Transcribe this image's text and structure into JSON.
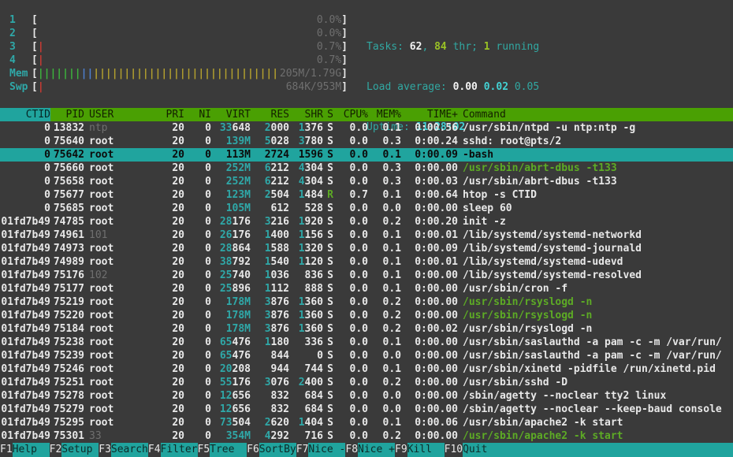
{
  "colors": {
    "background": "#3a3a3a",
    "header_bg": "#4aa003",
    "accent_teal": "#20a49e",
    "text": "#e8e8e8",
    "dim_gray": "#6f6f6f",
    "cyan_number": "#2fa8a8",
    "bright_cyan": "#43d1d3",
    "green_command": "#5dab25",
    "lime_bold": "#9ac225",
    "meter_red": "#cc3b33",
    "meter_green": "#3cb43c",
    "meter_blue": "#4d80d0",
    "meter_yellow": "#b3a02e"
  },
  "meters": [
    {
      "name": "cpu-1",
      "label": "1",
      "text": "0.0%",
      "pipes": []
    },
    {
      "name": "cpu-2",
      "label": "2",
      "text": "0.0%",
      "pipes": []
    },
    {
      "name": "cpu-3",
      "label": "3",
      "text": "0.7%",
      "pipes": [
        {
          "color": "red",
          "count": 1
        }
      ]
    },
    {
      "name": "cpu-4",
      "label": "4",
      "text": "0.7%",
      "pipes": [
        {
          "color": "red",
          "count": 1
        }
      ]
    },
    {
      "name": "memory",
      "label": "Mem",
      "text": "205M/1.79G",
      "pipes": [
        {
          "color": "green",
          "count": 7
        },
        {
          "color": "blue",
          "count": 2
        },
        {
          "color": "yellow",
          "count": 30
        }
      ]
    },
    {
      "name": "swap",
      "label": "Swp",
      "text": "684K/953M",
      "pipes": [
        {
          "color": "red",
          "count": 1
        }
      ]
    }
  ],
  "summary": {
    "tasks": [
      {
        "t": "Tasks: ",
        "c": "lbl"
      },
      {
        "t": "62",
        "c": "wb"
      },
      {
        "t": ", ",
        "c": "lbl"
      },
      {
        "t": "84",
        "c": "gb"
      },
      {
        "t": " thr; ",
        "c": "lbl"
      },
      {
        "t": "1",
        "c": "gb"
      },
      {
        "t": " running",
        "c": "lbl"
      }
    ],
    "load": [
      {
        "t": "Load average: ",
        "c": "lbl"
      },
      {
        "t": "0.00",
        "c": "wb"
      },
      {
        "t": " ",
        "c": "lbl"
      },
      {
        "t": "0.02",
        "c": "cb"
      },
      {
        "t": " ",
        "c": "lbl"
      },
      {
        "t": "0.05",
        "c": "lbl"
      }
    ],
    "uptime": [
      {
        "t": "Uptime: ",
        "c": "lbl"
      },
      {
        "t": "11:28:02",
        "c": "cb"
      }
    ]
  },
  "table": {
    "columns": [
      {
        "key": "ctid",
        "label": "CTID",
        "align": "r",
        "sorted": true
      },
      {
        "key": "pid",
        "label": "PID",
        "align": "r"
      },
      {
        "key": "user",
        "label": "USER",
        "align": "l"
      },
      {
        "key": "pri",
        "label": "PRI",
        "align": "r"
      },
      {
        "key": "ni",
        "label": "NI",
        "align": "r"
      },
      {
        "key": "virt",
        "label": "VIRT",
        "align": "r"
      },
      {
        "key": "res",
        "label": "RES",
        "align": "r"
      },
      {
        "key": "shr",
        "label": "SHR",
        "align": "r"
      },
      {
        "key": "s",
        "label": "S",
        "align": "r"
      },
      {
        "key": "cpu",
        "label": "CPU%",
        "align": "r"
      },
      {
        "key": "mem",
        "label": "MEM%",
        "align": "r"
      },
      {
        "key": "time",
        "label": "TIME+",
        "align": "r"
      },
      {
        "key": "cmd",
        "label": "Command",
        "align": "l"
      }
    ],
    "rows": [
      {
        "ctid": "0",
        "pid": "13832",
        "user": "ntp",
        "dimUser": true,
        "pri": "20",
        "ni": "0",
        "virt": "33648",
        "res": "2000",
        "shr": "1376",
        "s": "S",
        "cpu": "0.0",
        "mem": "0.1",
        "time": "0:00.56",
        "cmd": "/usr/sbin/ntpd -u ntp:ntp -g"
      },
      {
        "ctid": "0",
        "pid": "75640",
        "user": "root",
        "pri": "20",
        "ni": "0",
        "virt": "139M",
        "res": "5028",
        "shr": "3780",
        "s": "S",
        "cpu": "0.0",
        "mem": "0.3",
        "time": "0:00.24",
        "cmd": "sshd: root@pts/2"
      },
      {
        "ctid": "0",
        "pid": "75642",
        "user": "root",
        "pri": "20",
        "ni": "0",
        "virt": "113M",
        "res": "2724",
        "shr": "1596",
        "s": "S",
        "cpu": "0.0",
        "mem": "0.1",
        "time": "0:00.09",
        "cmd": "-bash",
        "selected": true
      },
      {
        "ctid": "0",
        "pid": "75660",
        "user": "root",
        "pri": "20",
        "ni": "0",
        "virt": "252M",
        "res": "6212",
        "shr": "4304",
        "s": "S",
        "cpu": "0.0",
        "mem": "0.3",
        "time": "0:00.00",
        "cmd": "/usr/sbin/abrt-dbus -t133",
        "greenCmd": true
      },
      {
        "ctid": "0",
        "pid": "75658",
        "user": "root",
        "pri": "20",
        "ni": "0",
        "virt": "252M",
        "res": "6212",
        "shr": "4304",
        "s": "S",
        "cpu": "0.0",
        "mem": "0.3",
        "time": "0:00.03",
        "cmd": "/usr/sbin/abrt-dbus -t133"
      },
      {
        "ctid": "0",
        "pid": "75677",
        "user": "root",
        "pri": "20",
        "ni": "0",
        "virt": "123M",
        "res": "2504",
        "shr": "1484",
        "s": "R",
        "cpu": "0.7",
        "mem": "0.1",
        "time": "0:00.64",
        "cmd": "htop -s CTID"
      },
      {
        "ctid": "0",
        "pid": "75685",
        "user": "root",
        "pri": "20",
        "ni": "0",
        "virt": "105M",
        "res": "612",
        "shr": "528",
        "s": "S",
        "cpu": "0.0",
        "mem": "0.0",
        "time": "0:00.00",
        "cmd": "sleep 60"
      },
      {
        "ctid": "01fd7b49",
        "pid": "74785",
        "user": "root",
        "pri": "20",
        "ni": "0",
        "virt": "28176",
        "res": "3216",
        "shr": "1920",
        "s": "S",
        "cpu": "0.0",
        "mem": "0.2",
        "time": "0:00.20",
        "cmd": "init -z"
      },
      {
        "ctid": "01fd7b49",
        "pid": "74961",
        "user": "101",
        "dimUser": true,
        "pri": "20",
        "ni": "0",
        "virt": "26176",
        "res": "1400",
        "shr": "1156",
        "s": "S",
        "cpu": "0.0",
        "mem": "0.1",
        "time": "0:00.01",
        "cmd": "/lib/systemd/systemd-networkd"
      },
      {
        "ctid": "01fd7b49",
        "pid": "74973",
        "user": "root",
        "pri": "20",
        "ni": "0",
        "virt": "28864",
        "res": "1588",
        "shr": "1320",
        "s": "S",
        "cpu": "0.0",
        "mem": "0.1",
        "time": "0:00.09",
        "cmd": "/lib/systemd/systemd-journald"
      },
      {
        "ctid": "01fd7b49",
        "pid": "74989",
        "user": "root",
        "pri": "20",
        "ni": "0",
        "virt": "38792",
        "res": "1540",
        "shr": "1120",
        "s": "S",
        "cpu": "0.0",
        "mem": "0.1",
        "time": "0:00.01",
        "cmd": "/lib/systemd/systemd-udevd"
      },
      {
        "ctid": "01fd7b49",
        "pid": "75176",
        "user": "102",
        "dimUser": true,
        "pri": "20",
        "ni": "0",
        "virt": "25740",
        "res": "1036",
        "shr": "836",
        "s": "S",
        "cpu": "0.0",
        "mem": "0.1",
        "time": "0:00.00",
        "cmd": "/lib/systemd/systemd-resolved"
      },
      {
        "ctid": "01fd7b49",
        "pid": "75177",
        "user": "root",
        "pri": "20",
        "ni": "0",
        "virt": "25896",
        "res": "1112",
        "shr": "888",
        "s": "S",
        "cpu": "0.0",
        "mem": "0.1",
        "time": "0:00.00",
        "cmd": "/usr/sbin/cron -f"
      },
      {
        "ctid": "01fd7b49",
        "pid": "75219",
        "user": "root",
        "pri": "20",
        "ni": "0",
        "virt": "178M",
        "res": "3876",
        "shr": "1360",
        "s": "S",
        "cpu": "0.0",
        "mem": "0.2",
        "time": "0:00.00",
        "cmd": "/usr/sbin/rsyslogd -n",
        "greenCmd": true
      },
      {
        "ctid": "01fd7b49",
        "pid": "75220",
        "user": "root",
        "pri": "20",
        "ni": "0",
        "virt": "178M",
        "res": "3876",
        "shr": "1360",
        "s": "S",
        "cpu": "0.0",
        "mem": "0.2",
        "time": "0:00.00",
        "cmd": "/usr/sbin/rsyslogd -n",
        "greenCmd": true
      },
      {
        "ctid": "01fd7b49",
        "pid": "75184",
        "user": "root",
        "pri": "20",
        "ni": "0",
        "virt": "178M",
        "res": "3876",
        "shr": "1360",
        "s": "S",
        "cpu": "0.0",
        "mem": "0.2",
        "time": "0:00.02",
        "cmd": "/usr/sbin/rsyslogd -n"
      },
      {
        "ctid": "01fd7b49",
        "pid": "75238",
        "user": "root",
        "pri": "20",
        "ni": "0",
        "virt": "65476",
        "res": "1180",
        "shr": "336",
        "s": "S",
        "cpu": "0.0",
        "mem": "0.1",
        "time": "0:00.00",
        "cmd": "/usr/sbin/saslauthd -a pam -c -m /var/run/"
      },
      {
        "ctid": "01fd7b49",
        "pid": "75239",
        "user": "root",
        "pri": "20",
        "ni": "0",
        "virt": "65476",
        "res": "844",
        "shr": "0",
        "s": "S",
        "cpu": "0.0",
        "mem": "0.0",
        "time": "0:00.00",
        "cmd": "/usr/sbin/saslauthd -a pam -c -m /var/run/"
      },
      {
        "ctid": "01fd7b49",
        "pid": "75246",
        "user": "root",
        "pri": "20",
        "ni": "0",
        "virt": "20208",
        "res": "944",
        "shr": "744",
        "s": "S",
        "cpu": "0.0",
        "mem": "0.1",
        "time": "0:00.00",
        "cmd": "/usr/sbin/xinetd -pidfile /run/xinetd.pid"
      },
      {
        "ctid": "01fd7b49",
        "pid": "75251",
        "user": "root",
        "pri": "20",
        "ni": "0",
        "virt": "55176",
        "res": "3076",
        "shr": "2400",
        "s": "S",
        "cpu": "0.0",
        "mem": "0.2",
        "time": "0:00.00",
        "cmd": "/usr/sbin/sshd -D"
      },
      {
        "ctid": "01fd7b49",
        "pid": "75278",
        "user": "root",
        "pri": "20",
        "ni": "0",
        "virt": "12656",
        "res": "832",
        "shr": "684",
        "s": "S",
        "cpu": "0.0",
        "mem": "0.0",
        "time": "0:00.00",
        "cmd": "/sbin/agetty --noclear tty2 linux"
      },
      {
        "ctid": "01fd7b49",
        "pid": "75279",
        "user": "root",
        "pri": "20",
        "ni": "0",
        "virt": "12656",
        "res": "832",
        "shr": "684",
        "s": "S",
        "cpu": "0.0",
        "mem": "0.0",
        "time": "0:00.00",
        "cmd": "/sbin/agetty --noclear --keep-baud console"
      },
      {
        "ctid": "01fd7b49",
        "pid": "75295",
        "user": "root",
        "pri": "20",
        "ni": "0",
        "virt": "73504",
        "res": "2620",
        "shr": "1404",
        "s": "S",
        "cpu": "0.0",
        "mem": "0.1",
        "time": "0:00.06",
        "cmd": "/usr/sbin/apache2 -k start"
      },
      {
        "ctid": "01fd7b49",
        "pid": "75301",
        "user": "33",
        "dimUser": true,
        "pri": "20",
        "ni": "0",
        "virt": "354M",
        "res": "4292",
        "shr": "716",
        "s": "S",
        "cpu": "0.0",
        "mem": "0.2",
        "time": "0:00.00",
        "cmd": "/usr/sbin/apache2 -k start",
        "greenCmd": true
      }
    ]
  },
  "fnbar": [
    {
      "key": "F1",
      "label": "Help  "
    },
    {
      "key": "F2",
      "label": "Setup "
    },
    {
      "key": "F3",
      "label": "Search"
    },
    {
      "key": "F4",
      "label": "Filter"
    },
    {
      "key": "F5",
      "label": "Tree  "
    },
    {
      "key": "F6",
      "label": "SortBy"
    },
    {
      "key": "F7",
      "label": "Nice -"
    },
    {
      "key": "F8",
      "label": "Nice +"
    },
    {
      "key": "F9",
      "label": "Kill  "
    },
    {
      "key": "F10",
      "label": "Quit  "
    }
  ]
}
